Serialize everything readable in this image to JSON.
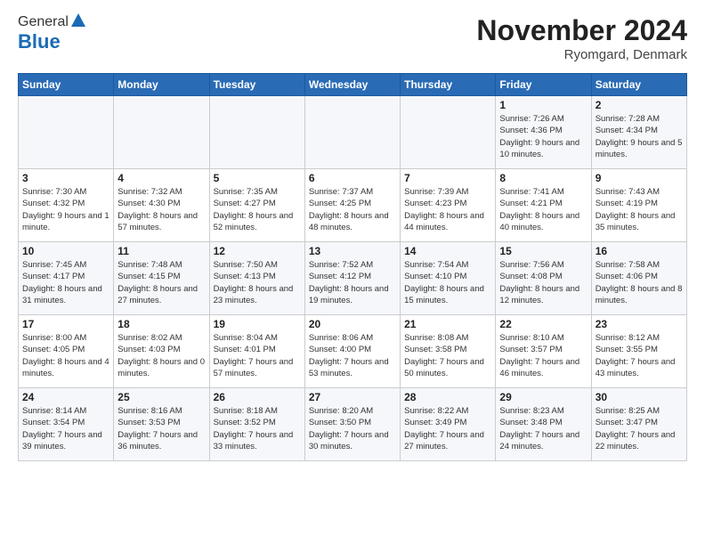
{
  "logo": {
    "general": "General",
    "blue": "Blue"
  },
  "title": "November 2024",
  "location": "Ryomgard, Denmark",
  "days_header": [
    "Sunday",
    "Monday",
    "Tuesday",
    "Wednesday",
    "Thursday",
    "Friday",
    "Saturday"
  ],
  "weeks": [
    [
      {
        "day": "",
        "info": ""
      },
      {
        "day": "",
        "info": ""
      },
      {
        "day": "",
        "info": ""
      },
      {
        "day": "",
        "info": ""
      },
      {
        "day": "",
        "info": ""
      },
      {
        "day": "1",
        "info": "Sunrise: 7:26 AM\nSunset: 4:36 PM\nDaylight: 9 hours and 10 minutes."
      },
      {
        "day": "2",
        "info": "Sunrise: 7:28 AM\nSunset: 4:34 PM\nDaylight: 9 hours and 5 minutes."
      }
    ],
    [
      {
        "day": "3",
        "info": "Sunrise: 7:30 AM\nSunset: 4:32 PM\nDaylight: 9 hours and 1 minute."
      },
      {
        "day": "4",
        "info": "Sunrise: 7:32 AM\nSunset: 4:30 PM\nDaylight: 8 hours and 57 minutes."
      },
      {
        "day": "5",
        "info": "Sunrise: 7:35 AM\nSunset: 4:27 PM\nDaylight: 8 hours and 52 minutes."
      },
      {
        "day": "6",
        "info": "Sunrise: 7:37 AM\nSunset: 4:25 PM\nDaylight: 8 hours and 48 minutes."
      },
      {
        "day": "7",
        "info": "Sunrise: 7:39 AM\nSunset: 4:23 PM\nDaylight: 8 hours and 44 minutes."
      },
      {
        "day": "8",
        "info": "Sunrise: 7:41 AM\nSunset: 4:21 PM\nDaylight: 8 hours and 40 minutes."
      },
      {
        "day": "9",
        "info": "Sunrise: 7:43 AM\nSunset: 4:19 PM\nDaylight: 8 hours and 35 minutes."
      }
    ],
    [
      {
        "day": "10",
        "info": "Sunrise: 7:45 AM\nSunset: 4:17 PM\nDaylight: 8 hours and 31 minutes."
      },
      {
        "day": "11",
        "info": "Sunrise: 7:48 AM\nSunset: 4:15 PM\nDaylight: 8 hours and 27 minutes."
      },
      {
        "day": "12",
        "info": "Sunrise: 7:50 AM\nSunset: 4:13 PM\nDaylight: 8 hours and 23 minutes."
      },
      {
        "day": "13",
        "info": "Sunrise: 7:52 AM\nSunset: 4:12 PM\nDaylight: 8 hours and 19 minutes."
      },
      {
        "day": "14",
        "info": "Sunrise: 7:54 AM\nSunset: 4:10 PM\nDaylight: 8 hours and 15 minutes."
      },
      {
        "day": "15",
        "info": "Sunrise: 7:56 AM\nSunset: 4:08 PM\nDaylight: 8 hours and 12 minutes."
      },
      {
        "day": "16",
        "info": "Sunrise: 7:58 AM\nSunset: 4:06 PM\nDaylight: 8 hours and 8 minutes."
      }
    ],
    [
      {
        "day": "17",
        "info": "Sunrise: 8:00 AM\nSunset: 4:05 PM\nDaylight: 8 hours and 4 minutes."
      },
      {
        "day": "18",
        "info": "Sunrise: 8:02 AM\nSunset: 4:03 PM\nDaylight: 8 hours and 0 minutes."
      },
      {
        "day": "19",
        "info": "Sunrise: 8:04 AM\nSunset: 4:01 PM\nDaylight: 7 hours and 57 minutes."
      },
      {
        "day": "20",
        "info": "Sunrise: 8:06 AM\nSunset: 4:00 PM\nDaylight: 7 hours and 53 minutes."
      },
      {
        "day": "21",
        "info": "Sunrise: 8:08 AM\nSunset: 3:58 PM\nDaylight: 7 hours and 50 minutes."
      },
      {
        "day": "22",
        "info": "Sunrise: 8:10 AM\nSunset: 3:57 PM\nDaylight: 7 hours and 46 minutes."
      },
      {
        "day": "23",
        "info": "Sunrise: 8:12 AM\nSunset: 3:55 PM\nDaylight: 7 hours and 43 minutes."
      }
    ],
    [
      {
        "day": "24",
        "info": "Sunrise: 8:14 AM\nSunset: 3:54 PM\nDaylight: 7 hours and 39 minutes."
      },
      {
        "day": "25",
        "info": "Sunrise: 8:16 AM\nSunset: 3:53 PM\nDaylight: 7 hours and 36 minutes."
      },
      {
        "day": "26",
        "info": "Sunrise: 8:18 AM\nSunset: 3:52 PM\nDaylight: 7 hours and 33 minutes."
      },
      {
        "day": "27",
        "info": "Sunrise: 8:20 AM\nSunset: 3:50 PM\nDaylight: 7 hours and 30 minutes."
      },
      {
        "day": "28",
        "info": "Sunrise: 8:22 AM\nSunset: 3:49 PM\nDaylight: 7 hours and 27 minutes."
      },
      {
        "day": "29",
        "info": "Sunrise: 8:23 AM\nSunset: 3:48 PM\nDaylight: 7 hours and 24 minutes."
      },
      {
        "day": "30",
        "info": "Sunrise: 8:25 AM\nSunset: 3:47 PM\nDaylight: 7 hours and 22 minutes."
      }
    ]
  ]
}
